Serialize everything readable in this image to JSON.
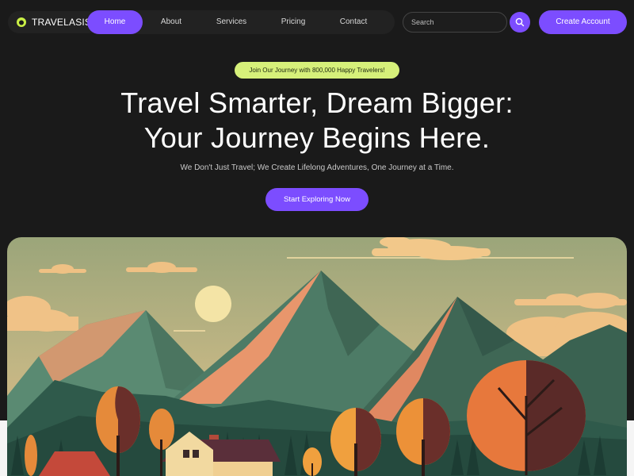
{
  "brand": {
    "name": "TRAVELASIS",
    "logo_color": "#c9ef45"
  },
  "nav": {
    "links": [
      "Home",
      "About",
      "Services",
      "Pricing",
      "Contact"
    ],
    "active_index": 0
  },
  "search": {
    "placeholder": "Search",
    "icon": "search-icon"
  },
  "header": {
    "cta_label": "Create Account"
  },
  "hero": {
    "badge": "Join Our Journey with 800,000 Happy Travelers!",
    "title_line1": "Travel Smarter, Dream Bigger:",
    "title_line2": "Your Journey Begins Here.",
    "subtitle": "We Don't Just Travel; We Create Lifelong Adventures, One Journey at a Time.",
    "cta_label": "Start Exploring Now"
  },
  "colors": {
    "accent": "#7c4dff",
    "badge_bg": "#d6f07a",
    "background": "#1a1a1a"
  }
}
